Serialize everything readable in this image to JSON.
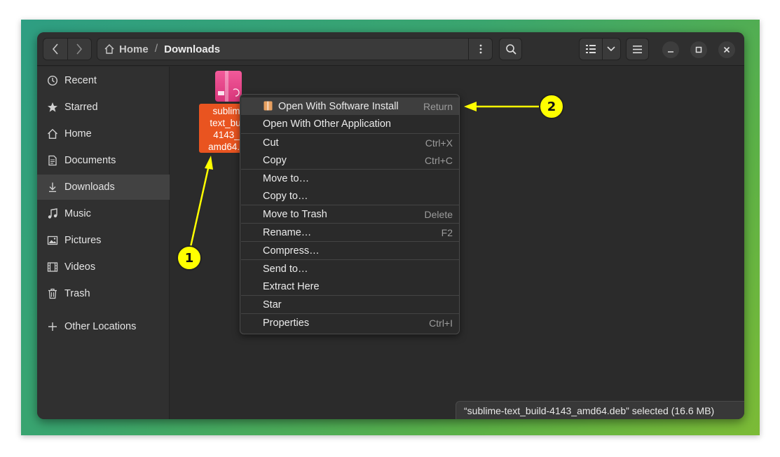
{
  "header": {
    "path_home": "Home",
    "path_separator": "/",
    "path_current": "Downloads"
  },
  "sidebar": {
    "items": [
      {
        "label": "Recent",
        "icon": "clock-icon"
      },
      {
        "label": "Starred",
        "icon": "star-icon"
      },
      {
        "label": "Home",
        "icon": "home-icon"
      },
      {
        "label": "Documents",
        "icon": "document-icon"
      },
      {
        "label": "Downloads",
        "icon": "download-icon",
        "active": true
      },
      {
        "label": "Music",
        "icon": "music-icon"
      },
      {
        "label": "Pictures",
        "icon": "picture-icon"
      },
      {
        "label": "Videos",
        "icon": "video-icon"
      },
      {
        "label": "Trash",
        "icon": "trash-icon"
      },
      {
        "label": "Other Locations",
        "icon": "plus-icon"
      }
    ]
  },
  "file": {
    "label_lines": [
      "sublim",
      "text_bui",
      "4143_",
      "amd64.c"
    ]
  },
  "context_menu": {
    "items": [
      {
        "label": "Open With Software Install",
        "accel": "Return"
      },
      {
        "label": "Open With Other Application",
        "accel": ""
      },
      {
        "label": "Cut",
        "accel": "Ctrl+X"
      },
      {
        "label": "Copy",
        "accel": "Ctrl+C"
      },
      {
        "label": "Move to…",
        "accel": ""
      },
      {
        "label": "Copy to…",
        "accel": ""
      },
      {
        "label": "Move to Trash",
        "accel": "Delete"
      },
      {
        "label": "Rename…",
        "accel": "F2"
      },
      {
        "label": "Compress…",
        "accel": ""
      },
      {
        "label": "Send to…",
        "accel": ""
      },
      {
        "label": "Extract Here",
        "accel": ""
      },
      {
        "label": "Star",
        "accel": ""
      },
      {
        "label": "Properties",
        "accel": "Ctrl+I"
      }
    ]
  },
  "statusbar": {
    "text": "“sublime-text_build-4143_amd64.deb” selected  (16.6 MB)"
  },
  "annotations": {
    "badge_1": "1",
    "badge_2": "2",
    "color": "#ffff00"
  }
}
